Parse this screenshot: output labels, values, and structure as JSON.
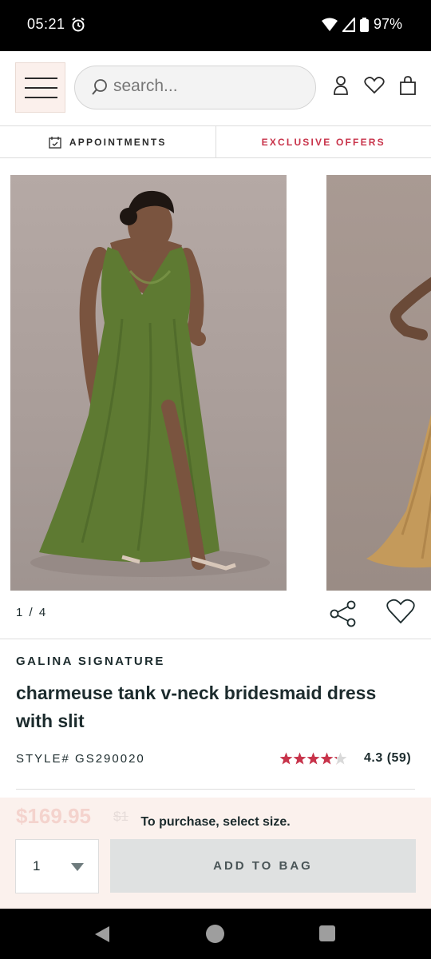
{
  "status_bar": {
    "time": "05:21",
    "battery": "97%",
    "icons": [
      "alarm-icon",
      "wifi-icon",
      "signal-icon",
      "battery-icon"
    ]
  },
  "header": {
    "menu_icon": "hamburger-menu-icon",
    "search_placeholder": "search...",
    "icons": [
      "account-icon",
      "heart-icon",
      "bag-icon"
    ]
  },
  "promo_bar": {
    "appointments_label": "APPOINTMENTS",
    "offers_label": "EXCLUSIVE OFFERS"
  },
  "gallery": {
    "counter": "1 / 4",
    "dress_colors": [
      "#5e7a32",
      "#c49a5b"
    ]
  },
  "product": {
    "brand": "GALINA SIGNATURE",
    "title": "charmeuse tank v-neck bridesmaid dress with slit",
    "style": "STYLE# GS290020",
    "rating": 4.3,
    "rating_text": "4.3 (59)",
    "review_count": 59
  },
  "purchase": {
    "price_ghost": "$169.95",
    "price_old_ghost": "$1",
    "message": "To purchase, select size.",
    "quantity": "1",
    "add_label": "ADD TO BAG"
  },
  "colors": {
    "accent": "#c8334a",
    "star": "#c8334a",
    "sheet_bg": "#fbf1ed",
    "button_bg": "#dfe1e1"
  }
}
